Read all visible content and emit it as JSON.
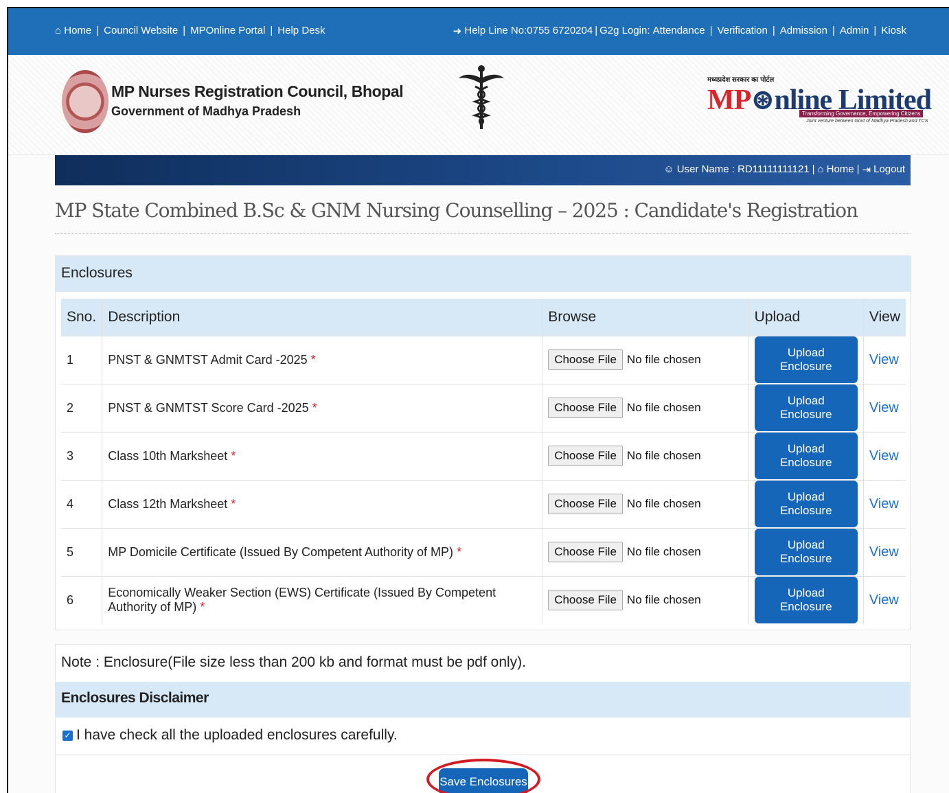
{
  "topbar": {
    "left_links": [
      "Home",
      "Council Website",
      "MPOnline Portal",
      "Help Desk"
    ],
    "helpline": "Help Line No:0755 6720204",
    "g2g": "G2g Login:",
    "right_links": [
      "Attendance",
      "Verification",
      "Admission",
      "Admin",
      "Kiosk"
    ]
  },
  "header": {
    "org_name": "MP Nurses Registration Council, Bhopal",
    "org_sub": "Government of Madhya Pradesh",
    "mpol_top": "मध्यप्रदेश सरकार का पोर्टल",
    "mpol_a": "MP",
    "mpol_b": "nline Limited",
    "mpol_tag": "Transforming Governance, Empowering Citizens",
    "mpol_tag2": "Joint venture between Govt of Madhya Pradesh and TCS"
  },
  "userbar": {
    "user": "User Name : RD11111111121",
    "home": "Home",
    "logout": "Logout"
  },
  "page_title": "MP State Combined B.Sc & GNM Nursing Counselling – 2025 : Candidate's Registration",
  "enclosures": {
    "heading": "Enclosures",
    "columns": [
      "Sno.",
      "Description",
      "Browse",
      "Upload",
      "View"
    ],
    "choose_label": "Choose File",
    "no_file": "No file chosen",
    "upload_label": "Upload Enclosure",
    "view_label": "View",
    "rows": [
      {
        "sno": "1",
        "desc": "PNST & GNMTST Admit Card -2025"
      },
      {
        "sno": "2",
        "desc": "PNST & GNMTST Score Card -2025"
      },
      {
        "sno": "3",
        "desc": "Class 10th Marksheet"
      },
      {
        "sno": "4",
        "desc": "Class 12th Marksheet"
      },
      {
        "sno": "5",
        "desc": "MP Domicile Certificate (Issued By Competent Authority of MP)"
      },
      {
        "sno": "6",
        "desc": "Economically Weaker Section (EWS) Certificate (Issued By Competent Authority of MP)"
      }
    ],
    "required_mark": "*"
  },
  "note": "Note : Enclosure(File size less than 200 kb and format must be pdf only).",
  "disclaimer": {
    "heading": "Enclosures Disclaimer",
    "text": "I have check all the uploaded enclosures carefully.",
    "checked": true
  },
  "save_label": "Save Enclosures",
  "colors": {
    "topbar": "#1f6fb8",
    "navy": "#0f2e5b",
    "button": "#1565b8",
    "panel_head": "#d7e8f6",
    "required": "#d9232a",
    "highlight": "#d21b22"
  }
}
